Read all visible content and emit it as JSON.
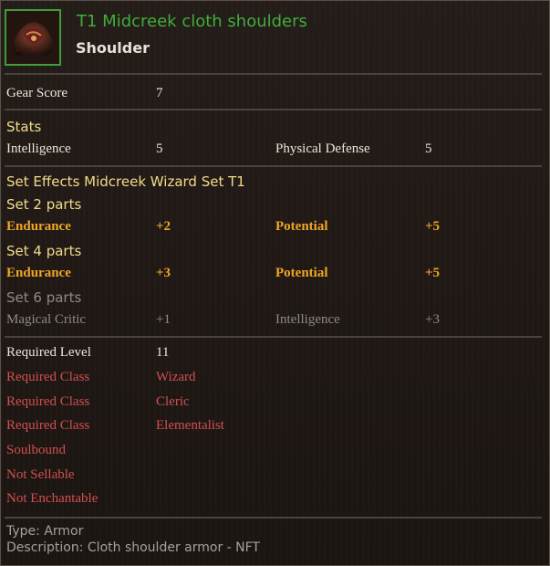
{
  "item": {
    "name": "T1 Midcreek cloth shoulders",
    "slot": "Shoulder",
    "icon": "cloth-shoulders-icon",
    "rarity_color": "#3fae3a"
  },
  "gear_score": {
    "label": "Gear Score",
    "value": "7"
  },
  "stats": {
    "heading": "Stats",
    "row": [
      {
        "label": "Intelligence",
        "value": "5"
      },
      {
        "label": "Physical Defense",
        "value": "5"
      }
    ]
  },
  "set_effects": {
    "heading": "Set Effects Midcreek Wizard Set T1",
    "tiers": [
      {
        "label": "Set 2 parts",
        "active": true,
        "bonuses": [
          {
            "label": "Endurance",
            "value": "+2"
          },
          {
            "label": "Potential",
            "value": "+5"
          }
        ]
      },
      {
        "label": "Set 4 parts",
        "active": true,
        "bonuses": [
          {
            "label": "Endurance",
            "value": "+3"
          },
          {
            "label": "Potential",
            "value": "+5"
          }
        ]
      },
      {
        "label": "Set 6 parts",
        "active": false,
        "bonuses": [
          {
            "label": "Magical Critic",
            "value": "+1"
          },
          {
            "label": "Intelligence",
            "value": "+3"
          }
        ]
      }
    ]
  },
  "requirements": [
    {
      "label": "Required Level",
      "value": "11",
      "met": true
    },
    {
      "label": "Required Class",
      "value": "Wizard",
      "met": false
    },
    {
      "label": "Required Class",
      "value": "Cleric",
      "met": false
    },
    {
      "label": "Required Class",
      "value": "Elementalist",
      "met": false
    }
  ],
  "flags": [
    "Soulbound",
    "Not Sellable",
    "Not Enchantable"
  ],
  "footer": {
    "type": "Type: Armor",
    "description": "Description: Cloth shoulder armor - NFT"
  },
  "colors": {
    "title_green": "#3fae3a",
    "section_yellow": "#f2dc8a",
    "active_bonus_orange": "#f0a626",
    "inactive_grey": "#8e8a84",
    "unmet_red": "#d24f4f"
  }
}
